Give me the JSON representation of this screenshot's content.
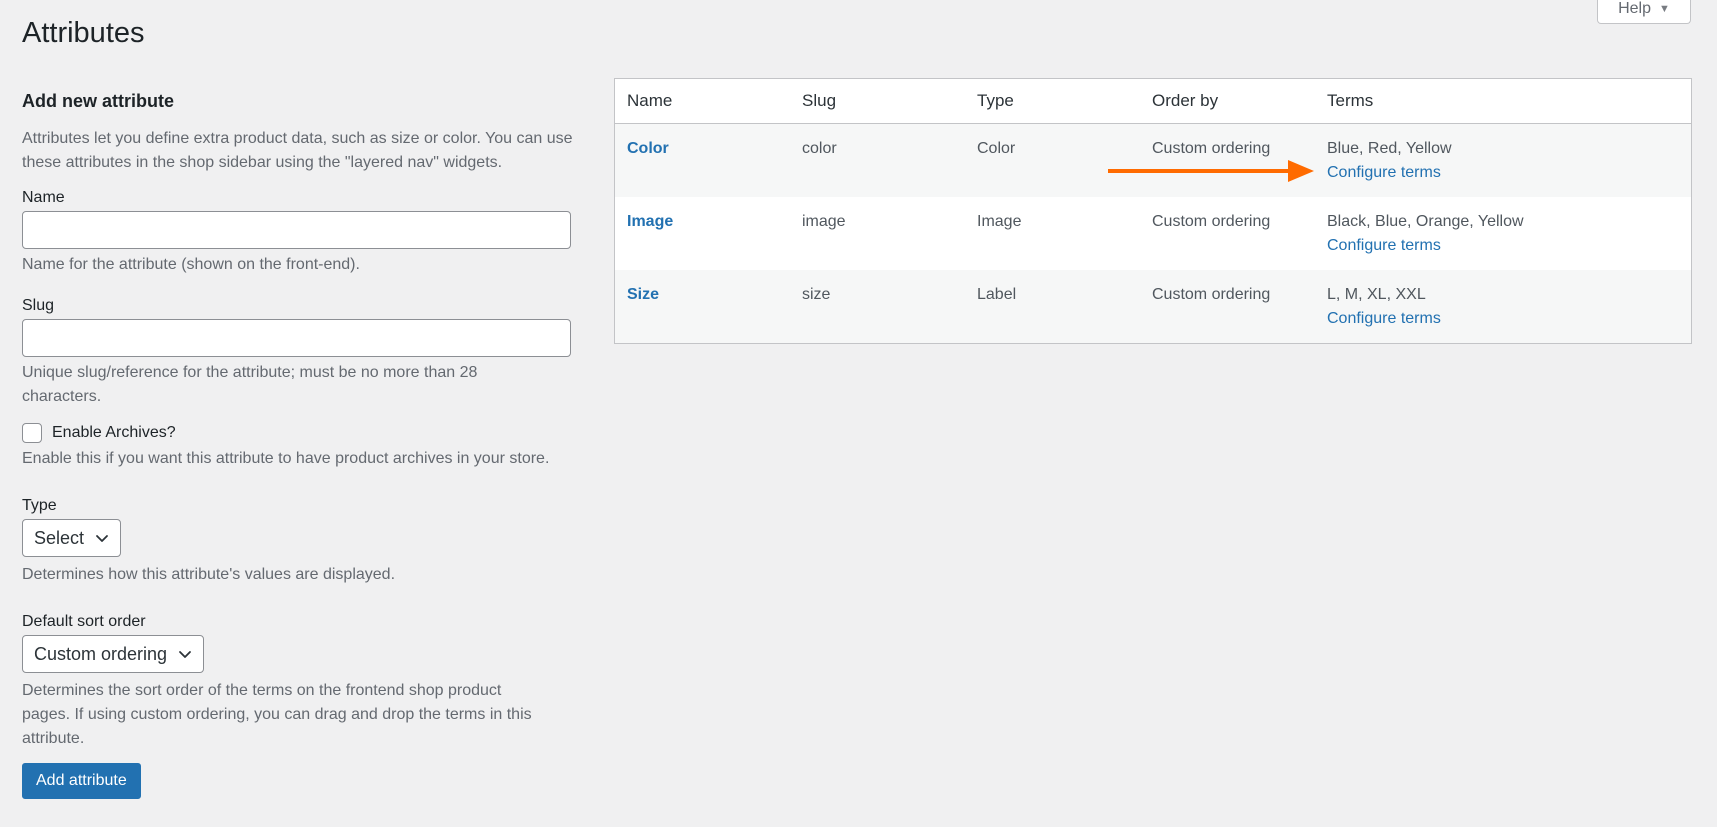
{
  "header": {
    "title": "Attributes",
    "help_label": "Help",
    "help_caret": "▼"
  },
  "form": {
    "section_title": "Add new attribute",
    "intro": "Attributes let you define extra product data, such as size or color. You can use these attributes in the shop sidebar using the \"layered nav\" widgets.",
    "name": {
      "label": "Name",
      "value": "",
      "help": "Name for the attribute (shown on the front-end)."
    },
    "slug": {
      "label": "Slug",
      "value": "",
      "help": "Unique slug/reference for the attribute; must be no more than 28 characters."
    },
    "archives": {
      "label": "Enable Archives?",
      "checked": false,
      "help": "Enable this if you want this attribute to have product archives in your store."
    },
    "type": {
      "label": "Type",
      "selected": "Select",
      "help": "Determines how this attribute's values are displayed."
    },
    "sort_order": {
      "label": "Default sort order",
      "selected": "Custom ordering",
      "help": "Determines the sort order of the terms on the frontend shop product pages. If using custom ordering, you can drag and drop the terms in this attribute."
    },
    "submit_label": "Add attribute"
  },
  "table": {
    "columns": [
      "Name",
      "Slug",
      "Type",
      "Order by",
      "Terms"
    ],
    "rows": [
      {
        "name": "Color",
        "slug": "color",
        "type": "Color",
        "order_by": "Custom ordering",
        "terms": "Blue, Red, Yellow",
        "configure_label": "Configure terms"
      },
      {
        "name": "Image",
        "slug": "image",
        "type": "Image",
        "order_by": "Custom ordering",
        "terms": "Black, Blue, Orange, Yellow",
        "configure_label": "Configure terms"
      },
      {
        "name": "Size",
        "slug": "size",
        "type": "Label",
        "order_by": "Custom ordering",
        "terms": "L, M, XL, XXL",
        "configure_label": "Configure terms"
      }
    ]
  },
  "annotation": {
    "arrow_color": "#ff6b00"
  },
  "colors": {
    "link": "#2271b1",
    "primary_button": "#2271b1",
    "background": "#f0f0f1"
  }
}
